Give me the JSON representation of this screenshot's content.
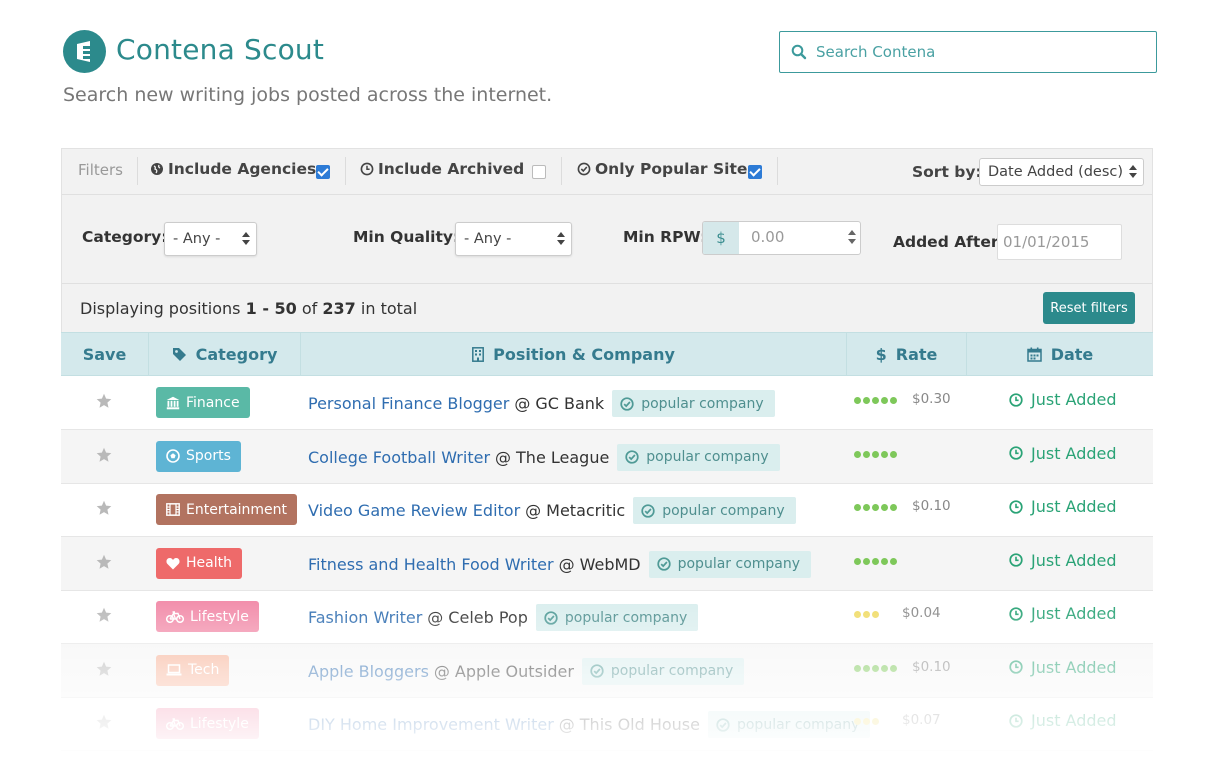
{
  "header": {
    "title": "Contena Scout",
    "subtitle": "Search new writing jobs posted across the internet.",
    "search_placeholder": "Search Contena",
    "brand_color": "#2c8a8c"
  },
  "filters": {
    "label": "Filters",
    "include_agencies": {
      "label": "Include Agencies",
      "checked": true
    },
    "include_archived": {
      "label": "Include Archived",
      "checked": false
    },
    "only_popular": {
      "label": "Only Popular Sites",
      "checked": true
    },
    "sort_label": "Sort by:",
    "sort_value": "Date Added (desc)",
    "category_label": "Category:",
    "category_value": "- Any -",
    "quality_label": "Min Quality:",
    "quality_value": "- Any -",
    "rpw_label": "Min RPW:",
    "rpw_currency": "$",
    "rpw_value": "0.00",
    "added_after_label": "Added After:",
    "added_after_value": "01/01/2015"
  },
  "results": {
    "prefix": "Displaying positions",
    "range": "1 - 50",
    "of": "of",
    "total": "237",
    "suffix": "in total",
    "reset_label": "Reset filters"
  },
  "table": {
    "headers": {
      "save": "Save",
      "category": "Category",
      "position": "Position & Company",
      "rate": "Rate",
      "date": "Date"
    },
    "rows": [
      {
        "category": "Finance",
        "category_icon": "bank-icon",
        "category_color": "#5ab9a6",
        "title": "Personal Finance Blogger",
        "at": "@",
        "company": "GC Bank",
        "badge": "popular company",
        "quality": 5,
        "quality_color": "#7ec85a",
        "rate": "$0.30",
        "date": "Just Added"
      },
      {
        "category": "Sports",
        "category_icon": "soccer-ball-icon",
        "category_color": "#5eb4d4",
        "title": "College Football Writer",
        "at": "@",
        "company": "The League",
        "badge": "popular company",
        "quality": 5,
        "quality_color": "#7ec85a",
        "rate": "",
        "date": "Just Added"
      },
      {
        "category": "Entertainment",
        "category_icon": "film-icon",
        "category_color": "#b27360",
        "title": "Video Game Review Editor",
        "at": "@",
        "company": "Metacritic",
        "badge": "popular company",
        "quality": 5,
        "quality_color": "#7ec85a",
        "rate": "$0.10",
        "date": "Just Added"
      },
      {
        "category": "Health",
        "category_icon": "heart-icon",
        "category_color": "#ee6a6a",
        "title": "Fitness and Health Food Writer",
        "at": "@",
        "company": "WebMD",
        "badge": "popular company",
        "quality": 5,
        "quality_color": "#7ec85a",
        "rate": "",
        "date": "Just Added"
      },
      {
        "category": "Lifestyle",
        "category_icon": "bicycle-icon",
        "category_color": "#f28eab",
        "title": "Fashion Writer",
        "at": "@",
        "company": "Celeb Pop",
        "badge": "popular company",
        "quality": 3,
        "quality_color": "#f0dc6a",
        "rate": "$0.04",
        "date": "Just Added"
      },
      {
        "category": "Tech",
        "category_icon": "laptop-icon",
        "category_color": "#f7b49a",
        "title": "Apple Bloggers",
        "at": "@",
        "company": "Apple Outsider",
        "badge": "popular company",
        "quality": 5,
        "quality_color": "#7ec85a",
        "rate": "$0.10",
        "date": "Just Added"
      },
      {
        "category": "Lifestyle",
        "category_icon": "bicycle-icon",
        "category_color": "#f28eab",
        "title": "DIY Home Improvement Writer",
        "at": "@",
        "company": "This Old House",
        "badge": "popular company",
        "quality": 3,
        "quality_color": "#f0dc6a",
        "rate": "$0.07",
        "date": "Just Added"
      }
    ]
  }
}
